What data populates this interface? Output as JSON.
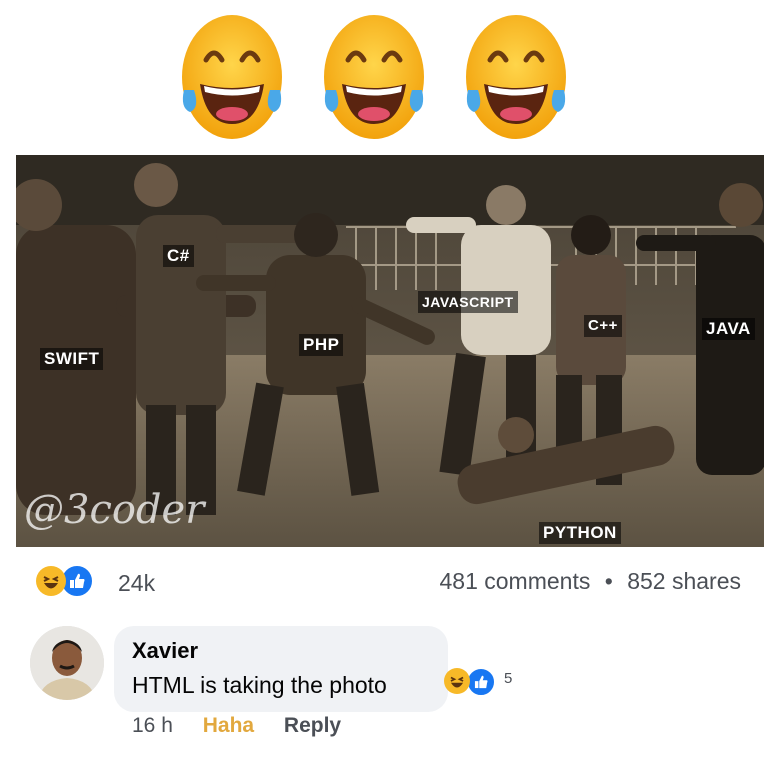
{
  "header_emojis": [
    "laughing-tears-emoji",
    "laughing-tears-emoji",
    "laughing-tears-emoji"
  ],
  "meme": {
    "labels": {
      "swift": "SWIFT",
      "csharp": "C#",
      "php": "PHP",
      "javascript": "JAVASCRIPT",
      "cpp": "C++",
      "java": "JAVA",
      "python": "PYTHON"
    },
    "watermark": "@3coder"
  },
  "post_stats": {
    "reaction_icons": [
      "haha-icon",
      "like-icon"
    ],
    "reaction_count": "24k",
    "comments": "481 comments",
    "separator": "•",
    "shares": "852 shares"
  },
  "comment": {
    "author": "Xavier",
    "text": "HTML is taking the photo",
    "reaction_icons": [
      "haha-icon",
      "like-icon"
    ],
    "reaction_count": "5",
    "time": "16 h",
    "haha_label": "Haha",
    "reply_label": "Reply"
  },
  "colors": {
    "like_blue": "#1877f2",
    "haha_yellow": "#f7b928",
    "haha_text": "#e2a83e",
    "bubble_bg": "#f0f2f5"
  }
}
